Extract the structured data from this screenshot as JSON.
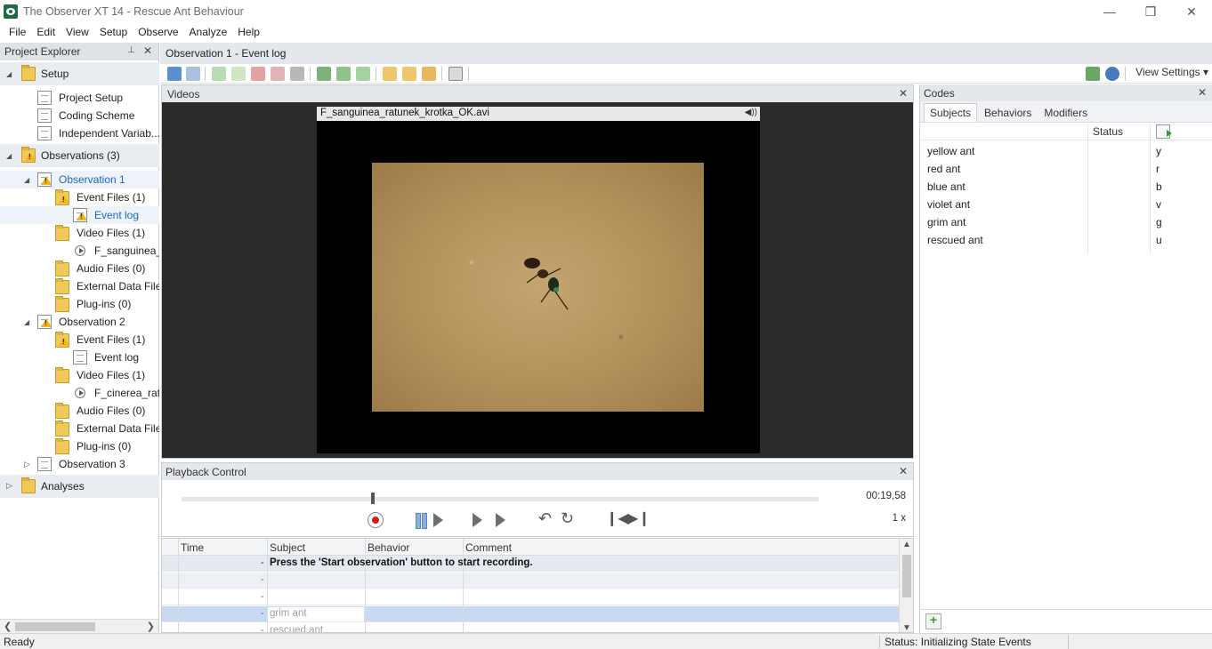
{
  "window": {
    "title": "The Observer XT 14 - Rescue Ant Behaviour",
    "minimize": "—",
    "restore": "❐",
    "close": "✕"
  },
  "menu": [
    "File",
    "Edit",
    "View",
    "Setup",
    "Observe",
    "Analyze",
    "Help"
  ],
  "explorer": {
    "title": "Project Explorer",
    "pin": "📌",
    "close": "✕",
    "setup": {
      "label": "Setup",
      "items": [
        "Project Setup",
        "Coding Scheme",
        "Independent Variab..."
      ]
    },
    "observations": {
      "label": "Observations (3)",
      "obs1": {
        "label": "Observation 1",
        "event_files": "Event Files (1)",
        "event_log": "Event log",
        "video_files": "Video Files (1)",
        "video_file": "F_sanguinea_",
        "audio_files": "Audio Files (0)",
        "external": "External Data Files",
        "plugins": "Plug-ins (0)"
      },
      "obs2": {
        "label": "Observation 2",
        "event_files": "Event Files (1)",
        "event_log": "Event log",
        "video_files": "Video Files (1)",
        "video_file": "F_cinerea_ratu",
        "audio_files": "Audio Files (0)",
        "external": "External Data Files",
        "plugins": "Plug-ins (0)"
      },
      "obs3": {
        "label": "Observation 3"
      }
    },
    "analyses": "Analyses"
  },
  "document": {
    "tab_title": "Observation 1 - Event log",
    "view_settings": "View Settings ▾"
  },
  "videos": {
    "title": "Videos",
    "close": "✕",
    "file_name": "F_sanguinea_ratunek_krotka_OK.avi",
    "speaker": "🔊"
  },
  "codes": {
    "title": "Codes",
    "close": "✕",
    "tabs": [
      "Subjects",
      "Behaviors",
      "Modifiers"
    ],
    "status_col": "Status",
    "rows": [
      {
        "name": "yellow ant",
        "key": "y"
      },
      {
        "name": "red ant",
        "key": "r"
      },
      {
        "name": "blue ant",
        "key": "b"
      },
      {
        "name": "violet ant",
        "key": "v"
      },
      {
        "name": "grim ant",
        "key": "g"
      },
      {
        "name": "rescued ant",
        "key": "u"
      }
    ]
  },
  "playback": {
    "title": "Playback Control",
    "close": "✕",
    "time": "00:19,58",
    "speed": "1 x",
    "position": 0.3
  },
  "event_log": {
    "columns": [
      "Time",
      "Subject",
      "Behavior",
      "Comment"
    ],
    "message": "Press the 'Start observation' button to start recording.",
    "rows": [
      {
        "dash": "-",
        "subject": ""
      },
      {
        "dash": "-",
        "subject": ""
      },
      {
        "dash": "-",
        "subject": "grim ant"
      },
      {
        "dash": "-",
        "subject": "rescued ant"
      }
    ]
  },
  "status": {
    "left": "Ready",
    "right": "Status: Initializing State Events"
  }
}
